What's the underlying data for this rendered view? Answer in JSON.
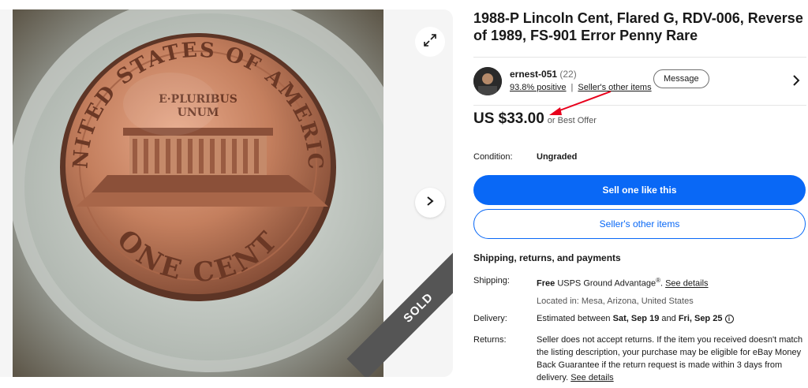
{
  "listing": {
    "title": "1988-P Lincoln Cent, Flared G, RDV-006, Reverse of 1989, FS-901 Error Penny Rare",
    "sold_badge": "SOLD"
  },
  "seller": {
    "name": "ernest-051",
    "feedback_count": "(22)",
    "positive": "93.8% positive",
    "other_items_link": "Seller's other items",
    "message_button": "Message"
  },
  "price": {
    "amount": "US $33.00",
    "best_offer": "or Best Offer"
  },
  "condition": {
    "label": "Condition:",
    "value": "Ungraded"
  },
  "actions": {
    "sell_one": "Sell one like this",
    "sellers_other_items": "Seller's other items"
  },
  "shipping": {
    "heading": "Shipping, returns, and payments",
    "shipping_label": "Shipping:",
    "shipping_free": "Free",
    "shipping_service": "USPS Ground Advantage",
    "shipping_reg": "®",
    "see_details": "See details",
    "located_in": "Located in: Mesa, Arizona, United States",
    "delivery_label": "Delivery:",
    "delivery_prefix": "Estimated between",
    "delivery_start": "Sat, Sep 19",
    "delivery_and": "and",
    "delivery_end": "Fri, Sep 25",
    "returns_label": "Returns:",
    "returns_text": "Seller does not accept returns. If the item you received doesn't match the listing description, your purchase may be eligible for eBay Money Back Guarantee if the return request is made within 3 days from delivery.",
    "returns_link": "See details"
  },
  "coin_text": {
    "top": "UNITED STATES OF AMERICA",
    "motto1": "E·PLURIBUS",
    "motto2": "UNUM",
    "bottom": "ONE CENT"
  },
  "colors": {
    "primary": "#0968f6",
    "ribbon": "#555555",
    "annotation_arrow": "#e8001c"
  }
}
